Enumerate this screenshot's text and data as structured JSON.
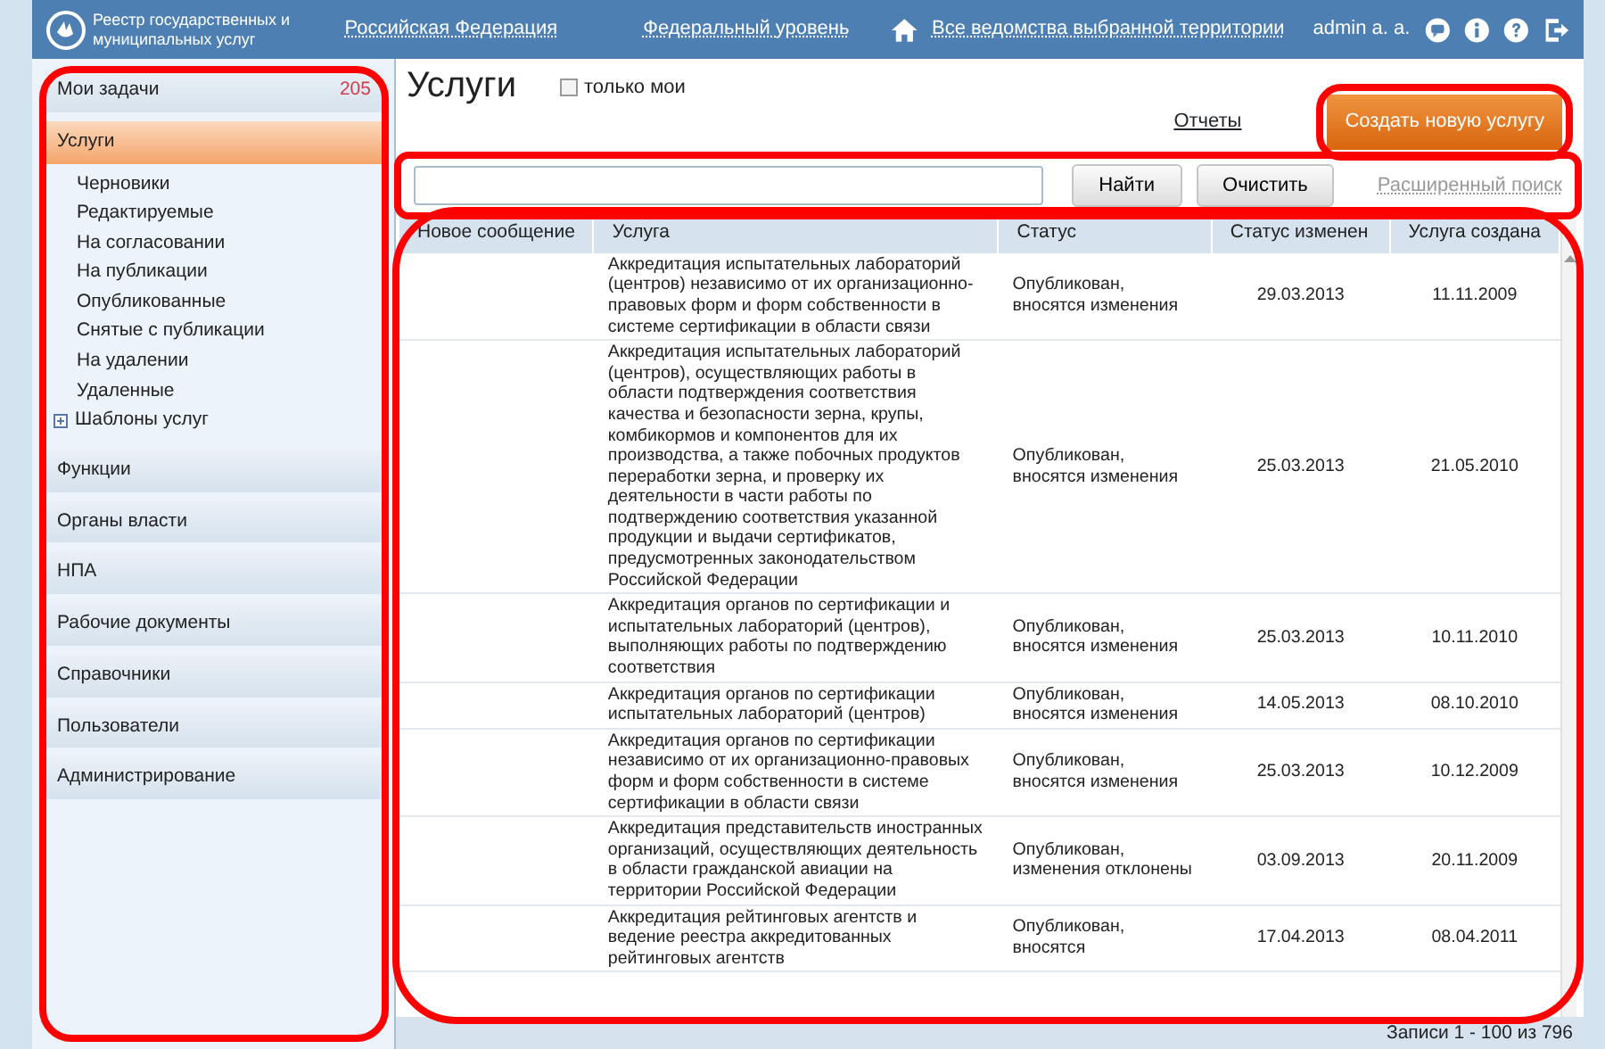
{
  "header": {
    "logo_text": "Реестр государственных и муниципальных услуг",
    "links": [
      "Российская Федерация",
      "Федеральный уровень"
    ],
    "territory_link": "Все ведомства выбранной территории",
    "user": "admin a. a."
  },
  "sidebar": {
    "sections": [
      {
        "label": "Мои задачи",
        "count": "205",
        "selected": false
      },
      {
        "label": "Услуги",
        "selected": true,
        "children": [
          {
            "label": "Черновики"
          },
          {
            "label": "Редактируемые"
          },
          {
            "label": "На согласовании"
          },
          {
            "label": "На публикации"
          },
          {
            "label": "Опубликованные"
          },
          {
            "label": "Снятые с публикации"
          },
          {
            "label": "На удалении"
          },
          {
            "label": "Удаленные"
          },
          {
            "label": "Шаблоны услуг",
            "expanded": false
          }
        ]
      },
      {
        "label": "Функции",
        "selected": false
      },
      {
        "label": "Органы власти",
        "selected": false
      },
      {
        "label": "НПА",
        "selected": false
      },
      {
        "label": "Рабочие документы",
        "selected": false
      },
      {
        "label": "Справочники",
        "selected": false
      },
      {
        "label": "Пользователи",
        "selected": false
      },
      {
        "label": "Администрирование",
        "selected": false
      }
    ]
  },
  "main": {
    "title": "Услуги",
    "only_mine": {
      "label": "только мои",
      "checked": false
    },
    "reports_link": "Отчеты",
    "create_button": "Создать новую услугу",
    "search": {
      "find_button": "Найти",
      "clear_button": "Очистить",
      "advanced_link": "Расширенный поиск"
    },
    "table": {
      "columns": [
        "Новое сообщение",
        "Услуга",
        "Статус",
        "Статус изменен",
        "Услуга создана"
      ],
      "rows": [
        [
          "",
          "Аккредитация испытательных лабораторий (центров) независимо от их организационно-правовых форм и форм собственности в системе сертификации в области связи",
          "Опубликован, вносятся изменения",
          "29.03.2013",
          "11.11.2009"
        ],
        [
          "",
          "Аккредитация испытательных лабораторий (центров), осуществляющих работы в области подтверждения соответствия качества и безопасности зерна, крупы, комбикормов и компонентов для их производства, а также побочных продуктов переработки зерна, и проверку их деятельности в части работы по подтверждению соответствия указанной продукции и выдачи сертификатов, предусмотренных законодательством Российской Федерации",
          "Опубликован, вносятся изменения",
          "25.03.2013",
          "21.05.2010"
        ],
        [
          "",
          "Аккредитация органов по сертификации и испытательных лабораторий (центров), выполняющих работы по подтверждению соответствия",
          "Опубликован, вносятся изменения",
          "25.03.2013",
          "10.11.2010"
        ],
        [
          "",
          "Аккредитация органов по сертификации испытательных лабораторий (центров)",
          "Опубликован, вносятся изменения",
          "14.05.2013",
          "08.10.2010"
        ],
        [
          "",
          "Аккредитация органов по сертификации независимо от их организационно-правовых форм и форм собственности в системе сертификации в области связи",
          "Опубликован, вносятся изменения",
          "25.03.2013",
          "10.12.2009"
        ],
        [
          "",
          "Аккредитация представительств иностранных организаций, осуществляющих деятельность в области гражданской авиации на территории Российской Федерации",
          "Опубликован, изменения отклонены",
          "03.09.2013",
          "20.11.2009"
        ],
        [
          "",
          "Аккредитация рейтинговых агентств и ведение реестра аккредитованных рейтинговых агентств",
          "Опубликован, вносятся",
          "17.04.2013",
          "08.04.2011"
        ]
      ]
    },
    "footer": "Записи 1 - 100 из 796"
  },
  "highlights": {
    "sidebar": true,
    "create_button": true,
    "search_bar": true,
    "table": true
  }
}
